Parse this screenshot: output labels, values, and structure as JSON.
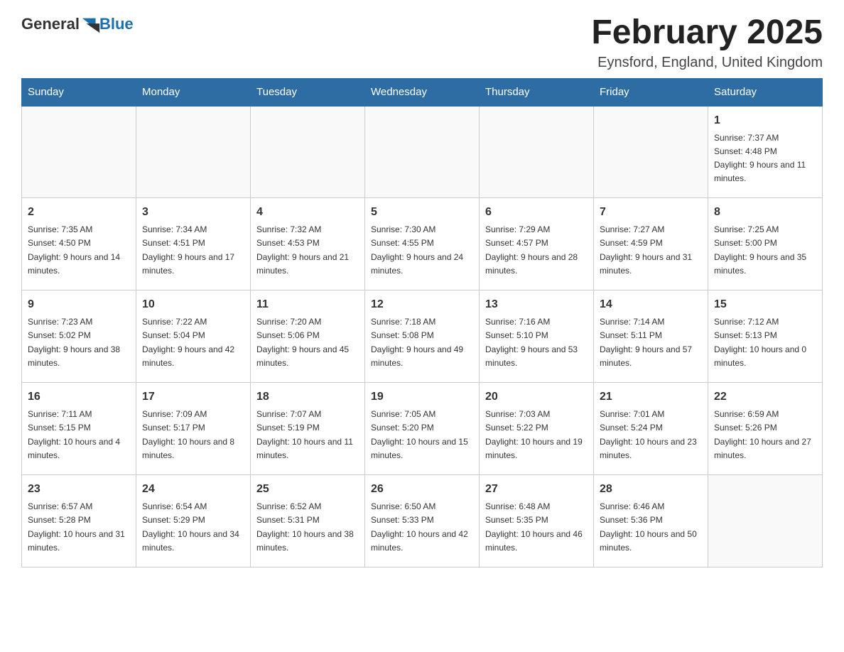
{
  "header": {
    "logo_general": "General",
    "logo_blue": "Blue",
    "title": "February 2025",
    "subtitle": "Eynsford, England, United Kingdom"
  },
  "days_of_week": [
    "Sunday",
    "Monday",
    "Tuesday",
    "Wednesday",
    "Thursday",
    "Friday",
    "Saturday"
  ],
  "weeks": [
    [
      {
        "day": "",
        "info": ""
      },
      {
        "day": "",
        "info": ""
      },
      {
        "day": "",
        "info": ""
      },
      {
        "day": "",
        "info": ""
      },
      {
        "day": "",
        "info": ""
      },
      {
        "day": "",
        "info": ""
      },
      {
        "day": "1",
        "info": "Sunrise: 7:37 AM\nSunset: 4:48 PM\nDaylight: 9 hours and 11 minutes."
      }
    ],
    [
      {
        "day": "2",
        "info": "Sunrise: 7:35 AM\nSunset: 4:50 PM\nDaylight: 9 hours and 14 minutes."
      },
      {
        "day": "3",
        "info": "Sunrise: 7:34 AM\nSunset: 4:51 PM\nDaylight: 9 hours and 17 minutes."
      },
      {
        "day": "4",
        "info": "Sunrise: 7:32 AM\nSunset: 4:53 PM\nDaylight: 9 hours and 21 minutes."
      },
      {
        "day": "5",
        "info": "Sunrise: 7:30 AM\nSunset: 4:55 PM\nDaylight: 9 hours and 24 minutes."
      },
      {
        "day": "6",
        "info": "Sunrise: 7:29 AM\nSunset: 4:57 PM\nDaylight: 9 hours and 28 minutes."
      },
      {
        "day": "7",
        "info": "Sunrise: 7:27 AM\nSunset: 4:59 PM\nDaylight: 9 hours and 31 minutes."
      },
      {
        "day": "8",
        "info": "Sunrise: 7:25 AM\nSunset: 5:00 PM\nDaylight: 9 hours and 35 minutes."
      }
    ],
    [
      {
        "day": "9",
        "info": "Sunrise: 7:23 AM\nSunset: 5:02 PM\nDaylight: 9 hours and 38 minutes."
      },
      {
        "day": "10",
        "info": "Sunrise: 7:22 AM\nSunset: 5:04 PM\nDaylight: 9 hours and 42 minutes."
      },
      {
        "day": "11",
        "info": "Sunrise: 7:20 AM\nSunset: 5:06 PM\nDaylight: 9 hours and 45 minutes."
      },
      {
        "day": "12",
        "info": "Sunrise: 7:18 AM\nSunset: 5:08 PM\nDaylight: 9 hours and 49 minutes."
      },
      {
        "day": "13",
        "info": "Sunrise: 7:16 AM\nSunset: 5:10 PM\nDaylight: 9 hours and 53 minutes."
      },
      {
        "day": "14",
        "info": "Sunrise: 7:14 AM\nSunset: 5:11 PM\nDaylight: 9 hours and 57 minutes."
      },
      {
        "day": "15",
        "info": "Sunrise: 7:12 AM\nSunset: 5:13 PM\nDaylight: 10 hours and 0 minutes."
      }
    ],
    [
      {
        "day": "16",
        "info": "Sunrise: 7:11 AM\nSunset: 5:15 PM\nDaylight: 10 hours and 4 minutes."
      },
      {
        "day": "17",
        "info": "Sunrise: 7:09 AM\nSunset: 5:17 PM\nDaylight: 10 hours and 8 minutes."
      },
      {
        "day": "18",
        "info": "Sunrise: 7:07 AM\nSunset: 5:19 PM\nDaylight: 10 hours and 11 minutes."
      },
      {
        "day": "19",
        "info": "Sunrise: 7:05 AM\nSunset: 5:20 PM\nDaylight: 10 hours and 15 minutes."
      },
      {
        "day": "20",
        "info": "Sunrise: 7:03 AM\nSunset: 5:22 PM\nDaylight: 10 hours and 19 minutes."
      },
      {
        "day": "21",
        "info": "Sunrise: 7:01 AM\nSunset: 5:24 PM\nDaylight: 10 hours and 23 minutes."
      },
      {
        "day": "22",
        "info": "Sunrise: 6:59 AM\nSunset: 5:26 PM\nDaylight: 10 hours and 27 minutes."
      }
    ],
    [
      {
        "day": "23",
        "info": "Sunrise: 6:57 AM\nSunset: 5:28 PM\nDaylight: 10 hours and 31 minutes."
      },
      {
        "day": "24",
        "info": "Sunrise: 6:54 AM\nSunset: 5:29 PM\nDaylight: 10 hours and 34 minutes."
      },
      {
        "day": "25",
        "info": "Sunrise: 6:52 AM\nSunset: 5:31 PM\nDaylight: 10 hours and 38 minutes."
      },
      {
        "day": "26",
        "info": "Sunrise: 6:50 AM\nSunset: 5:33 PM\nDaylight: 10 hours and 42 minutes."
      },
      {
        "day": "27",
        "info": "Sunrise: 6:48 AM\nSunset: 5:35 PM\nDaylight: 10 hours and 46 minutes."
      },
      {
        "day": "28",
        "info": "Sunrise: 6:46 AM\nSunset: 5:36 PM\nDaylight: 10 hours and 50 minutes."
      },
      {
        "day": "",
        "info": ""
      }
    ]
  ]
}
